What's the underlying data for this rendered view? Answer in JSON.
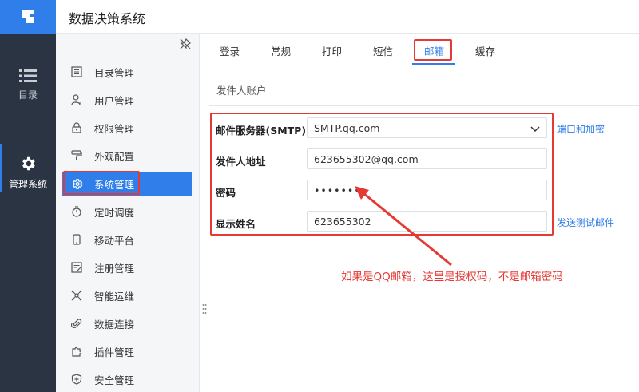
{
  "app": {
    "title": "数据决策系统"
  },
  "rail": {
    "items": [
      {
        "label": "目录",
        "icon": "list-icon"
      },
      {
        "label": "管理系统",
        "icon": "gear-icon",
        "active": true
      }
    ]
  },
  "subnav": {
    "items": [
      {
        "label": "目录管理",
        "icon": "catalog-icon"
      },
      {
        "label": "用户管理",
        "icon": "user-icon"
      },
      {
        "label": "权限管理",
        "icon": "lock-icon"
      },
      {
        "label": "外观配置",
        "icon": "paint-roller-icon"
      },
      {
        "label": "系统管理",
        "icon": "gear-icon",
        "active": true
      },
      {
        "label": "定时调度",
        "icon": "timer-icon"
      },
      {
        "label": "移动平台",
        "icon": "mobile-icon"
      },
      {
        "label": "注册管理",
        "icon": "register-icon"
      },
      {
        "label": "智能运维",
        "icon": "network-icon"
      },
      {
        "label": "数据连接",
        "icon": "paperclip-icon"
      },
      {
        "label": "插件管理",
        "icon": "puzzle-icon"
      },
      {
        "label": "安全管理",
        "icon": "shield-icon"
      }
    ]
  },
  "tabs": [
    {
      "label": "登录"
    },
    {
      "label": "常规"
    },
    {
      "label": "打印"
    },
    {
      "label": "短信"
    },
    {
      "label": "邮箱",
      "active": true
    },
    {
      "label": "缓存"
    }
  ],
  "section": {
    "title": "发件人账户"
  },
  "form": {
    "smtp": {
      "label": "邮件服务器(SMTP)",
      "value": "SMTP.qq.com"
    },
    "sender": {
      "label": "发件人地址",
      "value": "623655302@qq.com"
    },
    "password": {
      "label": "密码",
      "value": "••••••••"
    },
    "display_name": {
      "label": "显示姓名",
      "value": "623655302"
    }
  },
  "links": {
    "port_encryption": "端口和加密",
    "send_test": "发送测试邮件"
  },
  "annotation": {
    "text": "如果是QQ邮箱，这里是授权码，不是邮箱密码"
  },
  "colors": {
    "accent": "#2f7ee9",
    "rail_bg": "#2b3443",
    "annotation": "#e53935"
  }
}
